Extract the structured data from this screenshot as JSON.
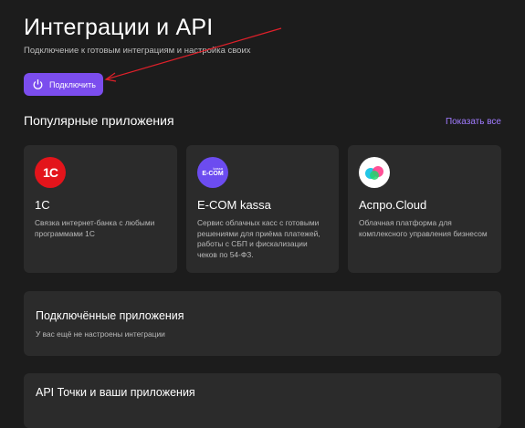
{
  "header": {
    "title": "Интеграции и API",
    "subtitle": "Подключение к готовым интеграциям и настройка своих",
    "connect_label": "Подключить",
    "connect_icon": "power-icon"
  },
  "popular": {
    "title": "Популярные приложения",
    "show_all": "Показать все",
    "apps": [
      {
        "name": "1С",
        "description": "Связка интернет-банка с любыми программами 1С",
        "logo_text": "1С",
        "logo_color": "#e3141b"
      },
      {
        "name": "E-COM kassa",
        "description": "Сервис облачных касс с готовыми решениями для приёма платежей, работы с СБП и фискализации чеков по 54-ФЗ.",
        "logo_small": "kassa",
        "logo_text": "E-COM",
        "logo_color": "#6c4cf0"
      },
      {
        "name": "Аспро.Cloud",
        "description": "Облачная платформа для комплексного управления бизнесом",
        "logo_color": "#ffffff"
      }
    ]
  },
  "connected": {
    "title": "Подключённые приложения",
    "empty": "У вас ещё не настроены интеграции"
  },
  "api": {
    "title": "API Точки и ваши приложения"
  },
  "colors": {
    "background": "#1c1c1c",
    "card": "#2b2b2b",
    "accent": "#7b4dee",
    "link": "#a07bff",
    "annotation_arrow": "#e0202a"
  }
}
